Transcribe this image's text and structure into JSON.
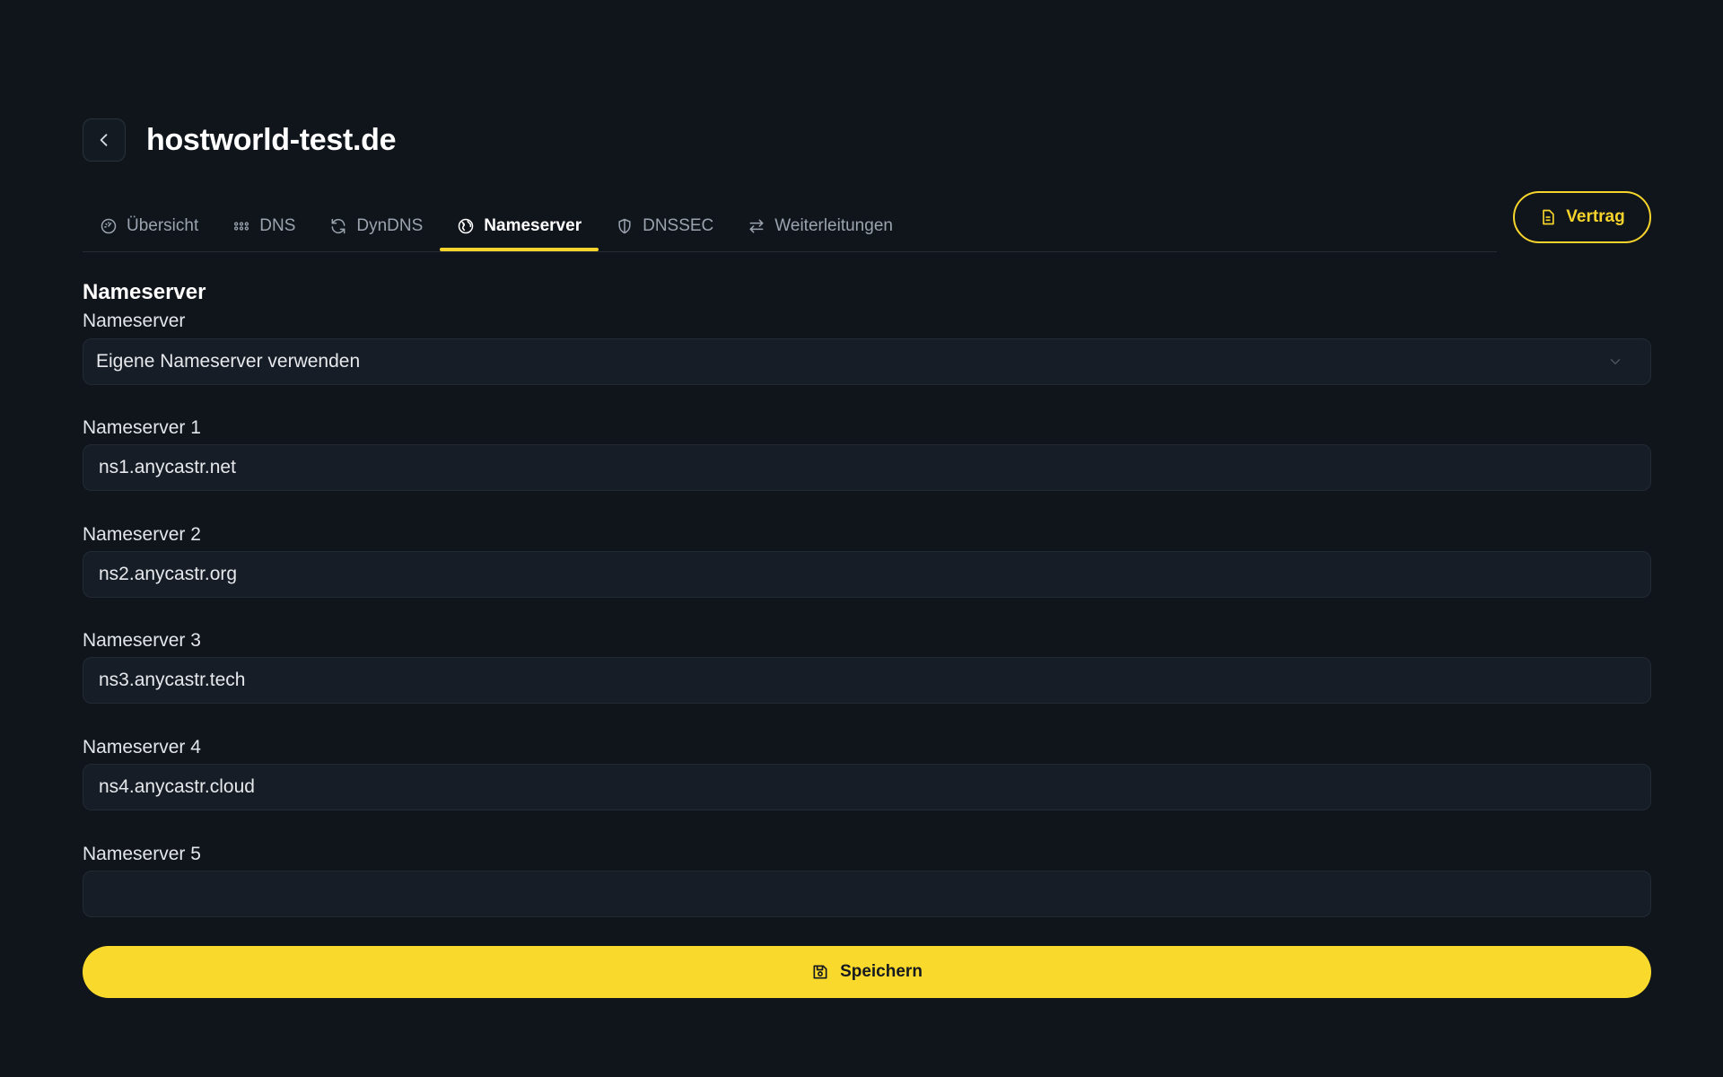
{
  "header": {
    "title": "hostworld-test.de",
    "back_icon": "chevron-left-icon"
  },
  "tabs": [
    {
      "label": "Übersicht",
      "icon": "gauge-icon",
      "active": false
    },
    {
      "label": "DNS",
      "icon": "grid-dots-icon",
      "active": false
    },
    {
      "label": "DynDNS",
      "icon": "refresh-icon",
      "active": false
    },
    {
      "label": "Nameserver",
      "icon": "globe-icon",
      "active": true
    },
    {
      "label": "DNSSEC",
      "icon": "shield-icon",
      "active": false
    },
    {
      "label": "Weiterleitungen",
      "icon": "arrows-swap-icon",
      "active": false
    }
  ],
  "contract_button": {
    "label": "Vertrag",
    "icon": "document-icon"
  },
  "form": {
    "section_title": "Nameserver",
    "mode": {
      "label": "Nameserver",
      "value": "Eigene Nameserver verwenden"
    },
    "nameservers": [
      {
        "label": "Nameserver 1",
        "value": "ns1.anycastr.net"
      },
      {
        "label": "Nameserver 2",
        "value": "ns2.anycastr.org"
      },
      {
        "label": "Nameserver 3",
        "value": "ns3.anycastr.tech"
      },
      {
        "label": "Nameserver 4",
        "value": "ns4.anycastr.cloud"
      },
      {
        "label": "Nameserver 5",
        "value": ""
      }
    ]
  },
  "save_button": {
    "label": "Speichern",
    "icon": "save-icon"
  },
  "colors": {
    "background": "#10151c",
    "accent": "#f6d42b",
    "field_bg": "#161d26",
    "tab_inactive": "#9aa3ae"
  }
}
